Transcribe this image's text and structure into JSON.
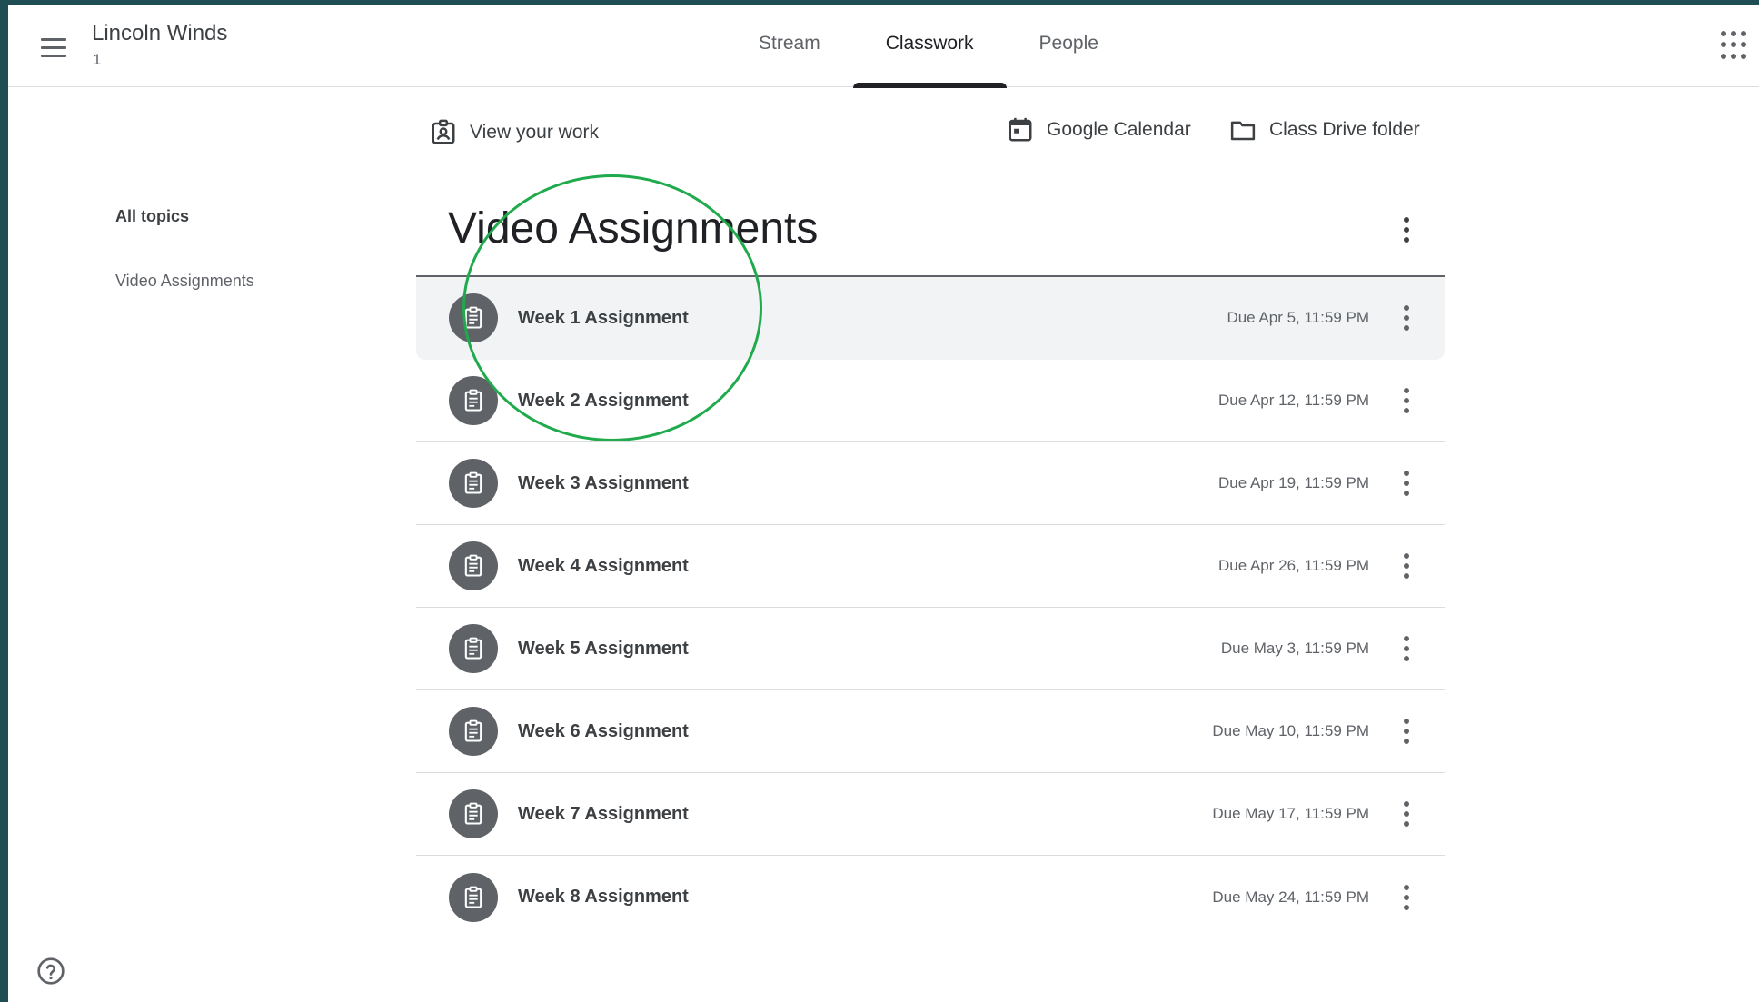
{
  "header": {
    "class_title": "Lincoln Winds",
    "class_section": "1",
    "tabs": [
      {
        "label": "Stream",
        "active": false
      },
      {
        "label": "Classwork",
        "active": true
      },
      {
        "label": "People",
        "active": false
      }
    ]
  },
  "links": {
    "view_work": "View your work",
    "calendar": "Google Calendar",
    "drive": "Class Drive folder"
  },
  "topics": [
    {
      "label": "All topics",
      "active": true
    },
    {
      "label": "Video Assignments",
      "active": false
    }
  ],
  "section": {
    "title": "Video Assignments",
    "assignments": [
      {
        "title": "Week 1 Assignment",
        "due": "Due Apr 5, 11:59 PM"
      },
      {
        "title": "Week 2 Assignment",
        "due": "Due Apr 12, 11:59 PM"
      },
      {
        "title": "Week 3 Assignment",
        "due": "Due Apr 19, 11:59 PM"
      },
      {
        "title": "Week 4 Assignment",
        "due": "Due Apr 26, 11:59 PM"
      },
      {
        "title": "Week 5 Assignment",
        "due": "Due May 3, 11:59 PM"
      },
      {
        "title": "Week 6 Assignment",
        "due": "Due May 10, 11:59 PM"
      },
      {
        "title": "Week 7 Assignment",
        "due": "Due May 17, 11:59 PM"
      },
      {
        "title": "Week 8 Assignment",
        "due": "Due May 24, 11:59 PM"
      }
    ]
  },
  "colors": {
    "annotation": "#1faa4c",
    "icon_bg": "#5f6368",
    "hover_row": "#f1f3f4",
    "outer_border": "#1e4e53"
  },
  "icons": {
    "menu": "hamburger-menu-icon",
    "apps": "google-apps-icon",
    "view_work": "assignment-ind-icon",
    "calendar": "calendar-icon",
    "drive": "folder-icon",
    "assignment": "clipboard-assignment-icon",
    "more": "more-vert-icon",
    "help": "help-icon"
  }
}
